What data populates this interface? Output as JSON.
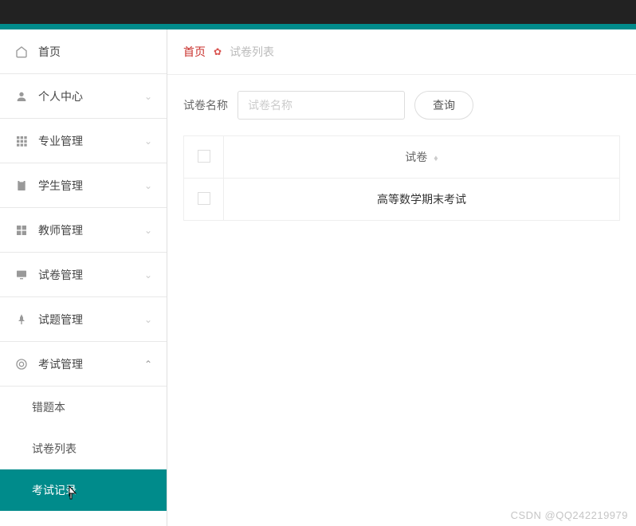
{
  "sidebar": {
    "items": [
      {
        "icon": "home",
        "label": "首页"
      },
      {
        "icon": "person",
        "label": "个人中心"
      },
      {
        "icon": "grid",
        "label": "专业管理"
      },
      {
        "icon": "clipboard",
        "label": "学生管理"
      },
      {
        "icon": "squares",
        "label": "教师管理"
      },
      {
        "icon": "monitor",
        "label": "试卷管理"
      },
      {
        "icon": "pin",
        "label": "试题管理"
      },
      {
        "icon": "target",
        "label": "考试管理"
      }
    ],
    "submenu": [
      {
        "label": "错题本"
      },
      {
        "label": "试卷列表"
      },
      {
        "label": "考试记录"
      }
    ]
  },
  "breadcrumb": {
    "home": "首页",
    "current": "试卷列表"
  },
  "filter": {
    "label": "试卷名称",
    "placeholder": "试卷名称",
    "query_btn": "查询"
  },
  "table": {
    "header": "试卷",
    "rows": [
      {
        "name": "高等数学期末考试"
      }
    ]
  },
  "watermark": "CSDN @QQ242219979"
}
